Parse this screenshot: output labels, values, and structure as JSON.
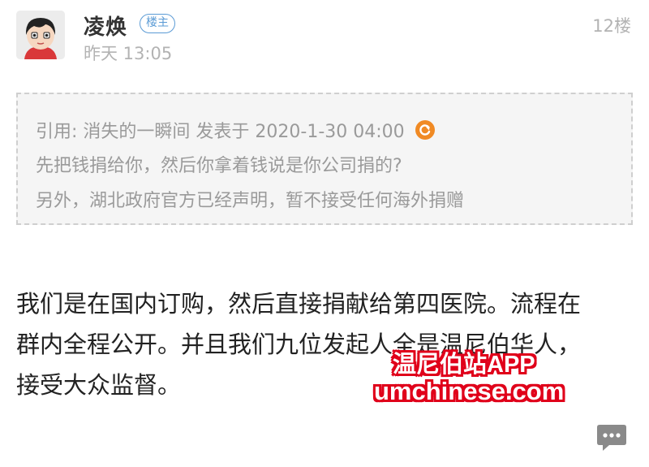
{
  "post": {
    "author": "凌焕",
    "badge": "楼主",
    "time": "昨天 13:05",
    "floor": "12楼",
    "avatar_icon": "cartoon-avatar-icon"
  },
  "quote": {
    "header": "引用: 消失的一瞬间 发表于 2020-1-30 04:00",
    "lines": [
      "先把钱捐给你，然后你拿着钱说是你公司捐的?",
      "另外，湖北政府官方已经声明，暂不接受任何海外捐赠"
    ],
    "jump_icon": "goto-arrow-icon",
    "accent_color": "#f08a24"
  },
  "body": {
    "lines": [
      "我们是在国内订购，然后直接捐献给第四医院。流程在",
      "群内全程公开。并且我们九位发起人全是温尼伯华人，",
      "接受大众监督。"
    ]
  },
  "watermark": {
    "line1": "温尼伯站APP",
    "line2": "umchinese.com",
    "color": "#e0001a"
  },
  "actions": {
    "comment_icon": "comment-bubble-icon"
  }
}
